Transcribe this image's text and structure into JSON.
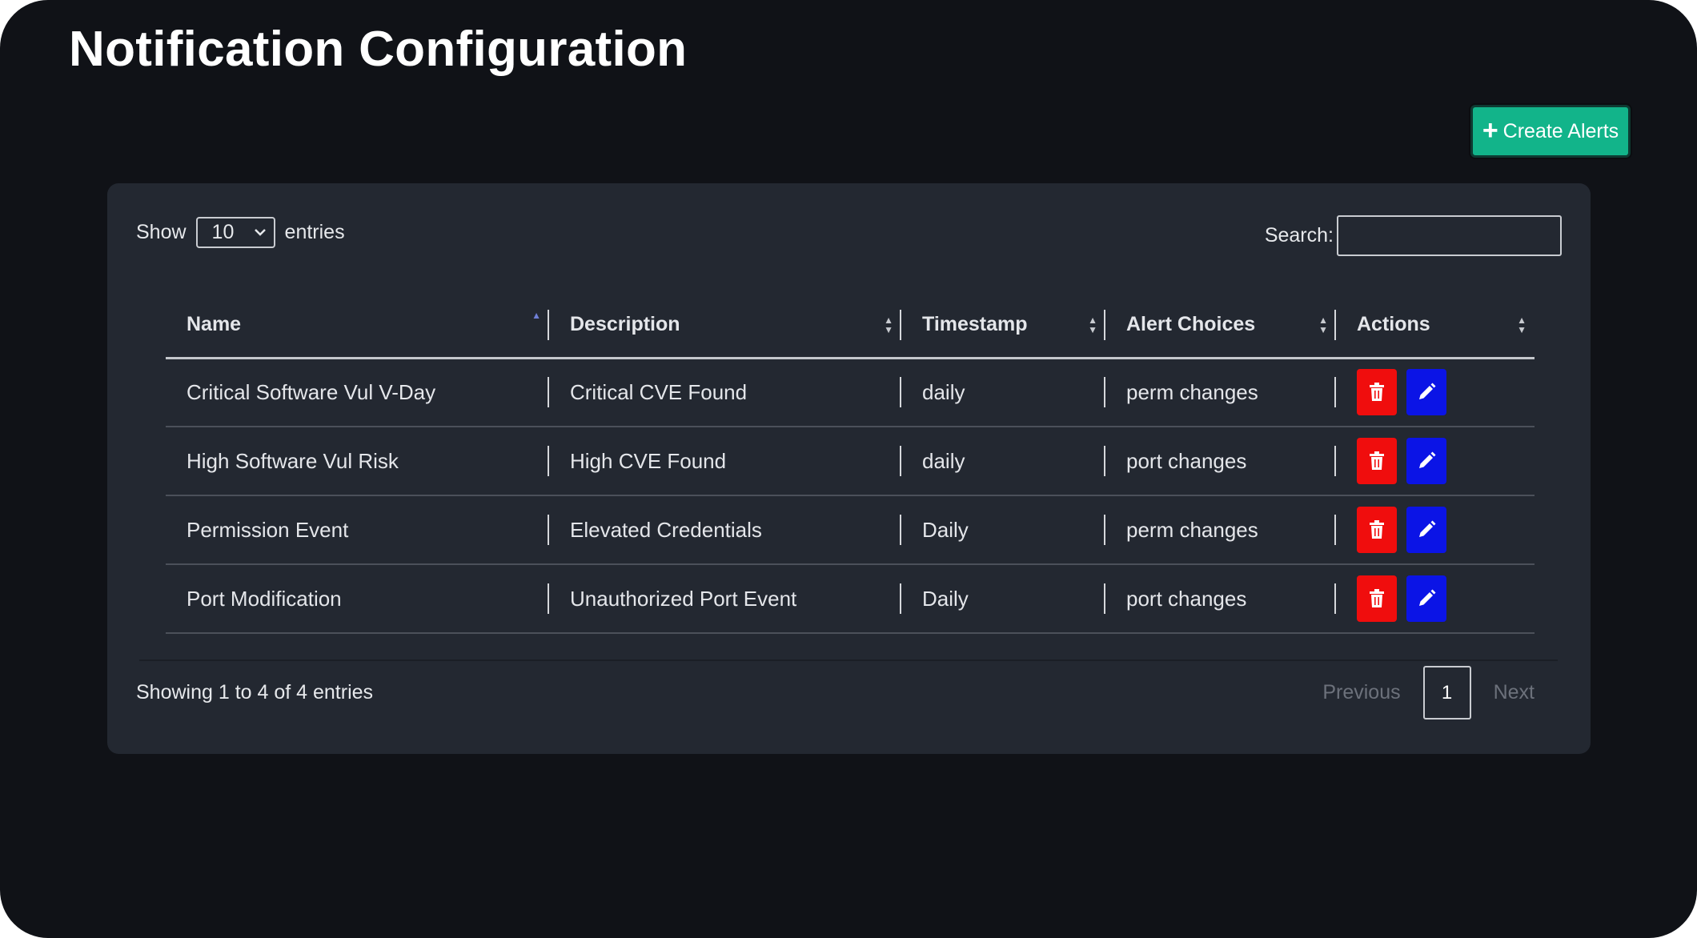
{
  "page": {
    "title": "Notification Configuration",
    "create_button_label": "Create Alerts",
    "create_button_icon": "plus-icon"
  },
  "table_controls": {
    "show_label": "Show",
    "entries_value": "10",
    "entries_label": "entries",
    "search_label": "Search:",
    "search_value": ""
  },
  "columns": [
    "Name",
    "Description",
    "Timestamp",
    "Alert Choices",
    "Actions"
  ],
  "sort": {
    "column": "Name",
    "direction": "ascending"
  },
  "rows": [
    {
      "name": "Critical Software Vul V-Day",
      "description": "Critical CVE Found",
      "timestamp": "daily",
      "alert_choices": "perm changes"
    },
    {
      "name": "High Software Vul Risk",
      "description": "High CVE Found",
      "timestamp": "daily",
      "alert_choices": "port changes"
    },
    {
      "name": "Permission Event",
      "description": "Elevated Credentials",
      "timestamp": "Daily",
      "alert_choices": "perm changes"
    },
    {
      "name": "Port Modification",
      "description": "Unauthorized Port Event",
      "timestamp": "Daily",
      "alert_choices": "port changes"
    }
  ],
  "row_actions": {
    "delete_icon": "trash-icon",
    "edit_icon": "pencil-icon"
  },
  "footer": {
    "info": "Showing 1 to 4 of 4 entries",
    "previous": "Previous",
    "current_page": "1",
    "next": "Next"
  },
  "colors": {
    "background": "#101217",
    "card": "#232831",
    "create_button": "#12b48a",
    "delete_button": "#f00d0d",
    "edit_button": "#0b14e6",
    "sort_active": "#6f7fd6"
  }
}
